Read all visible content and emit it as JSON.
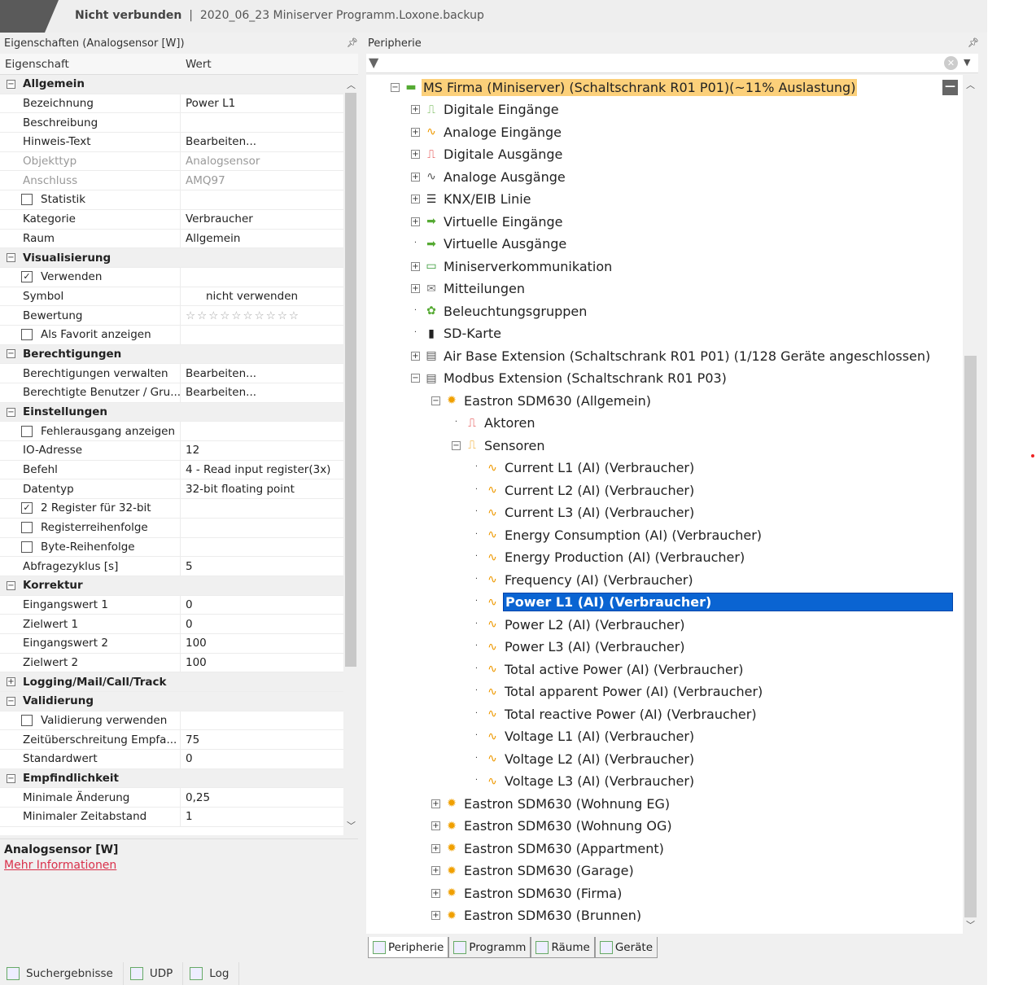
{
  "title": {
    "status": "Nicht verbunden",
    "separator": "|",
    "file": "2020_06_23 Miniserver Programm.Loxone.backup"
  },
  "properties": {
    "panel_title": "Eigenschaften (Analogsensor [W])",
    "col_name": "Eigenschaft",
    "col_value": "Wert",
    "rows": [
      {
        "type": "group",
        "name": "Allgemein",
        "expanded": true
      },
      {
        "name": "Bezeichnung",
        "value": "Power L1"
      },
      {
        "name": "Beschreibung",
        "value": ""
      },
      {
        "name": "Hinweis-Text",
        "value": "Bearbeiten..."
      },
      {
        "name": "Objekttyp",
        "value": "Analogsensor",
        "disabled": true
      },
      {
        "name": "Anschluss",
        "value": "AMQ97",
        "disabled": true
      },
      {
        "type": "check",
        "name": "Statistik",
        "checked": false
      },
      {
        "name": "Kategorie",
        "value": "Verbraucher"
      },
      {
        "name": "Raum",
        "value": "Allgemein"
      },
      {
        "type": "group",
        "name": "Visualisierung",
        "expanded": true
      },
      {
        "type": "check",
        "name": "Verwenden",
        "checked": true
      },
      {
        "name": "Symbol",
        "value": "nicht verwenden",
        "indent": true
      },
      {
        "type": "stars",
        "name": "Bewertung",
        "stars": 0,
        "max": 10
      },
      {
        "type": "check",
        "name": "Als Favorit anzeigen",
        "checked": false
      },
      {
        "type": "group",
        "name": "Berechtigungen",
        "expanded": true
      },
      {
        "name": "Berechtigungen verwalten",
        "value": "Bearbeiten..."
      },
      {
        "name": "Berechtigte Benutzer / Gru...",
        "value": "Bearbeiten..."
      },
      {
        "type": "group",
        "name": "Einstellungen",
        "expanded": true
      },
      {
        "type": "check",
        "name": "Fehlerausgang anzeigen",
        "checked": false
      },
      {
        "name": "IO-Adresse",
        "value": "12"
      },
      {
        "name": "Befehl",
        "value": "4 - Read input register(3x)"
      },
      {
        "name": "Datentyp",
        "value": "32-bit floating point"
      },
      {
        "type": "check",
        "name": "2 Register für 32-bit",
        "checked": true
      },
      {
        "type": "check",
        "name": "Registerreihenfolge",
        "checked": false
      },
      {
        "type": "check",
        "name": "Byte-Reihenfolge",
        "checked": false
      },
      {
        "name": "Abfragezyklus [s]",
        "value": "5"
      },
      {
        "type": "group",
        "name": "Korrektur",
        "expanded": true
      },
      {
        "name": "Eingangswert 1",
        "value": "0"
      },
      {
        "name": "Zielwert 1",
        "value": "0"
      },
      {
        "name": "Eingangswert 2",
        "value": "100"
      },
      {
        "name": "Zielwert 2",
        "value": "100"
      },
      {
        "type": "group",
        "name": "Logging/Mail/Call/Track",
        "expanded": false
      },
      {
        "type": "group",
        "name": "Validierung",
        "expanded": true
      },
      {
        "type": "check",
        "name": "Validierung verwenden",
        "checked": false
      },
      {
        "name": "Zeitüberschreitung Empfa...",
        "value": "75"
      },
      {
        "name": "Standardwert",
        "value": "0"
      },
      {
        "type": "group",
        "name": "Empfindlichkeit",
        "expanded": true
      },
      {
        "name": "Minimale Änderung",
        "value": "0,25"
      },
      {
        "name": "Minimaler Zeitabstand",
        "value": "1"
      }
    ]
  },
  "info": {
    "title": "Analogsensor [W]",
    "link": "Mehr Informationen"
  },
  "bottom_tabs": [
    "Suchergebnisse",
    "UDP",
    "Log"
  ],
  "peripherie": {
    "panel_title": "Peripherie",
    "tree": [
      {
        "level": 0,
        "exp": "-",
        "icon": "miniserver-icon",
        "label": "MS Firma (Miniserver) (Schaltschrank R01 P01)(~11% Auslastung)",
        "root": true
      },
      {
        "level": 1,
        "exp": "+",
        "icon": "digital-input-icon",
        "label": "Digitale Eingänge"
      },
      {
        "level": 1,
        "exp": "+",
        "icon": "analog-input-icon",
        "label": "Analoge Eingänge"
      },
      {
        "level": 1,
        "exp": "+",
        "icon": "digital-output-icon",
        "label": "Digitale Ausgänge"
      },
      {
        "level": 1,
        "exp": "+",
        "icon": "analog-output-icon",
        "label": "Analoge Ausgänge"
      },
      {
        "level": 1,
        "exp": "+",
        "icon": "knx-icon",
        "label": "KNX/EIB Linie"
      },
      {
        "level": 1,
        "exp": "+",
        "icon": "virtual-input-icon",
        "label": "Virtuelle Eingänge"
      },
      {
        "level": 1,
        "exp": "",
        "icon": "virtual-output-icon",
        "label": "Virtuelle Ausgänge"
      },
      {
        "level": 1,
        "exp": "+",
        "icon": "monitor-icon",
        "label": "Miniserverkommunikation"
      },
      {
        "level": 1,
        "exp": "+",
        "icon": "message-icon",
        "label": "Mitteilungen"
      },
      {
        "level": 1,
        "exp": "",
        "icon": "lighting-group-icon",
        "label": "Beleuchtungsgruppen"
      },
      {
        "level": 1,
        "exp": "",
        "icon": "sd-card-icon",
        "label": "SD-Karte"
      },
      {
        "level": 1,
        "exp": "+",
        "icon": "extension-icon",
        "label": "Air Base Extension (Schaltschrank R01 P01) (1/128 Geräte angeschlossen)"
      },
      {
        "level": 1,
        "exp": "-",
        "icon": "modbus-extension-icon",
        "label": "Modbus Extension (Schaltschrank R01 P03)"
      },
      {
        "level": 2,
        "exp": "-",
        "icon": "meter-icon",
        "label": "Eastron SDM630 (Allgemein)"
      },
      {
        "level": 3,
        "exp": "",
        "icon": "actuator-icon",
        "label": "Aktoren"
      },
      {
        "level": 3,
        "exp": "-",
        "icon": "sensor-icon",
        "label": "Sensoren"
      },
      {
        "level": 4,
        "exp": "",
        "icon": "analog-sensor-icon",
        "label": "Current L1 (AI) (Verbraucher)"
      },
      {
        "level": 4,
        "exp": "",
        "icon": "analog-sensor-icon",
        "label": "Current L2 (AI) (Verbraucher)"
      },
      {
        "level": 4,
        "exp": "",
        "icon": "analog-sensor-icon",
        "label": "Current L3 (AI) (Verbraucher)"
      },
      {
        "level": 4,
        "exp": "",
        "icon": "analog-sensor-icon",
        "label": "Energy Consumption (AI) (Verbraucher)"
      },
      {
        "level": 4,
        "exp": "",
        "icon": "analog-sensor-icon",
        "label": "Energy Production (AI) (Verbraucher)"
      },
      {
        "level": 4,
        "exp": "",
        "icon": "analog-sensor-icon",
        "label": "Frequency (AI) (Verbraucher)"
      },
      {
        "level": 4,
        "exp": "",
        "icon": "analog-sensor-icon",
        "label": "Power L1 (AI) (Verbraucher)",
        "selected": true
      },
      {
        "level": 4,
        "exp": "",
        "icon": "analog-sensor-icon",
        "label": "Power L2 (AI) (Verbraucher)"
      },
      {
        "level": 4,
        "exp": "",
        "icon": "analog-sensor-icon",
        "label": "Power L3 (AI) (Verbraucher)"
      },
      {
        "level": 4,
        "exp": "",
        "icon": "analog-sensor-icon",
        "label": "Total active Power (AI) (Verbraucher)"
      },
      {
        "level": 4,
        "exp": "",
        "icon": "analog-sensor-icon",
        "label": "Total apparent Power (AI) (Verbraucher)"
      },
      {
        "level": 4,
        "exp": "",
        "icon": "analog-sensor-icon",
        "label": "Total reactive Power (AI) (Verbraucher)"
      },
      {
        "level": 4,
        "exp": "",
        "icon": "analog-sensor-icon",
        "label": "Voltage L1 (AI) (Verbraucher)"
      },
      {
        "level": 4,
        "exp": "",
        "icon": "analog-sensor-icon",
        "label": "Voltage L2 (AI) (Verbraucher)"
      },
      {
        "level": 4,
        "exp": "",
        "icon": "analog-sensor-icon",
        "label": "Voltage L3 (AI) (Verbraucher)"
      },
      {
        "level": 2,
        "exp": "+",
        "icon": "meter-icon",
        "label": "Eastron SDM630 (Wohnung EG)"
      },
      {
        "level": 2,
        "exp": "+",
        "icon": "meter-icon",
        "label": "Eastron SDM630 (Wohnung OG)"
      },
      {
        "level": 2,
        "exp": "+",
        "icon": "meter-icon",
        "label": "Eastron SDM630 (Appartment)"
      },
      {
        "level": 2,
        "exp": "+",
        "icon": "meter-icon",
        "label": "Eastron SDM630 (Garage)"
      },
      {
        "level": 2,
        "exp": "+",
        "icon": "meter-icon",
        "label": "Eastron SDM630 (Firma)"
      },
      {
        "level": 2,
        "exp": "+",
        "icon": "meter-icon",
        "label": "Eastron SDM630 (Brunnen)"
      }
    ],
    "tabs": [
      {
        "label": "Peripherie",
        "active": true
      },
      {
        "label": "Programm"
      },
      {
        "label": "Räume"
      },
      {
        "label": "Geräte"
      }
    ]
  },
  "colors": {
    "selection": "#0a64d2",
    "root_highlight": "#fcd07a",
    "link": "#d9304a"
  }
}
